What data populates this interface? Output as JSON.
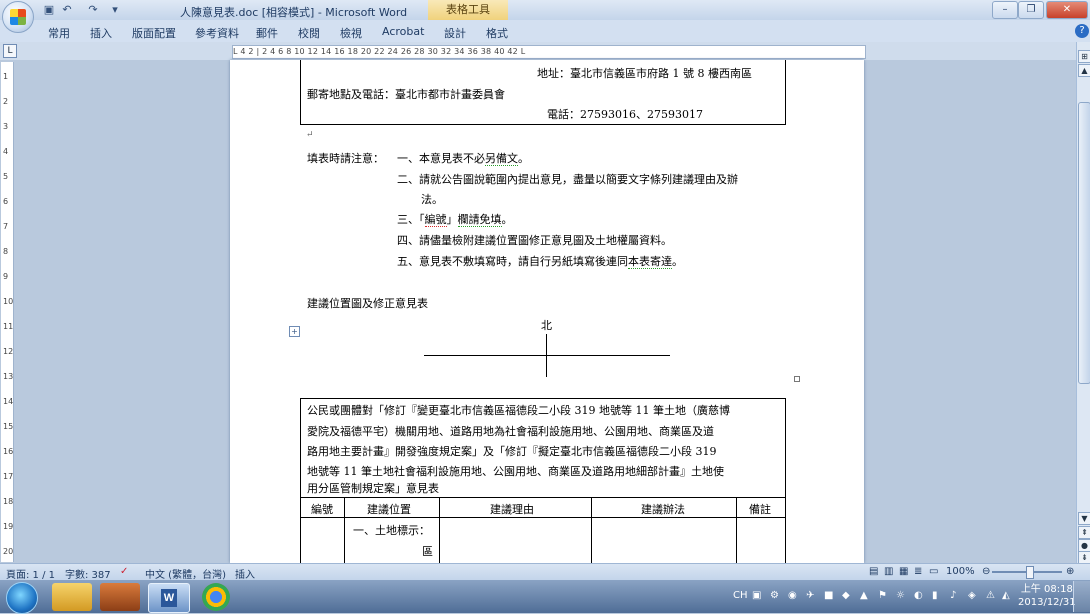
{
  "window": {
    "title": "人陳意見表.doc [相容模式] - Microsoft Word",
    "context_tab": "表格工具"
  },
  "ribbon": {
    "tabs": [
      "常用",
      "插入",
      "版面配置",
      "參考資料",
      "郵件",
      "校閱",
      "檢視",
      "Acrobat",
      "設計",
      "格式"
    ]
  },
  "ruler": {
    "h_text": "L  4  2  |  2  4  6  8  10  12  14  16  18  20  22  24  26  28  30  32  34  36  38  40  42  L",
    "v_marks": [
      "1",
      "2",
      "3",
      "4",
      "5",
      "6",
      "7",
      "8",
      "9",
      "10",
      "11",
      "12",
      "13",
      "14",
      "15",
      "16",
      "17",
      "18",
      "19",
      "20"
    ]
  },
  "document": {
    "address_line": "地址：臺北市信義區市府路 1 號 8 樓西南區",
    "mail_line": "郵寄地點及電話：臺北市都市計畫委員會",
    "phone_line": "電話：27593016、27593017",
    "notes_label": "填表時請注意：",
    "note1_prefix": "一、本意見表不必",
    "note1_word": "另備文",
    "note1_suffix": "。",
    "note2_line1": "二、請就公告圖說範圍內提出意見，盡量以簡要文字條列建議理由及辦",
    "note2_line2": "法。",
    "note3_prefix": "三、「",
    "note3_word": "編號",
    "note3_mid": "」",
    "note3_word2": "欄請免填",
    "note3_suffix": "。",
    "note4": "四、請儘量檢附建議位置圖修正意見圖及土地權屬資料。",
    "note5_prefix": "五、意見表不敷填寫時，請自行另紙填寫後連同",
    "note5_word": "本表寄達",
    "note5_suffix": "。",
    "map_heading": "建議位置圖及修正意見表",
    "north_label": "北",
    "opinion_para": [
      "公民或團體對「修訂『變更臺北市信義區福德段二小段 319 地號等 11 筆土地（廣慈博",
      "愛院及福德平宅）機關用地、道路用地為社會福利設施用地、公園用地、商業區及道",
      "路用地主要計畫』開發強度規定案」及「修訂『擬定臺北市信義區福德段二小段 319",
      "地號等 11 筆土地社會福利設施用地、公園用地、商業區及道路用地細部計畫』土地使",
      "用分區管制規定案」意見表"
    ],
    "table_headers": [
      "編號",
      "建議位置",
      "建議理由",
      "建議辦法",
      "備註"
    ],
    "row1_location_a": "一、土地標示：",
    "row1_location_b": "區"
  },
  "statusbar": {
    "page": "頁面: 1 / 1",
    "words": "字數: 387",
    "language": "中文 (繁體，台灣)",
    "mode": "插入",
    "zoom": "100%"
  },
  "taskbar": {
    "clock_time": "上午 08:18",
    "clock_date": "2013/12/31",
    "lang_indicator": "CH"
  }
}
